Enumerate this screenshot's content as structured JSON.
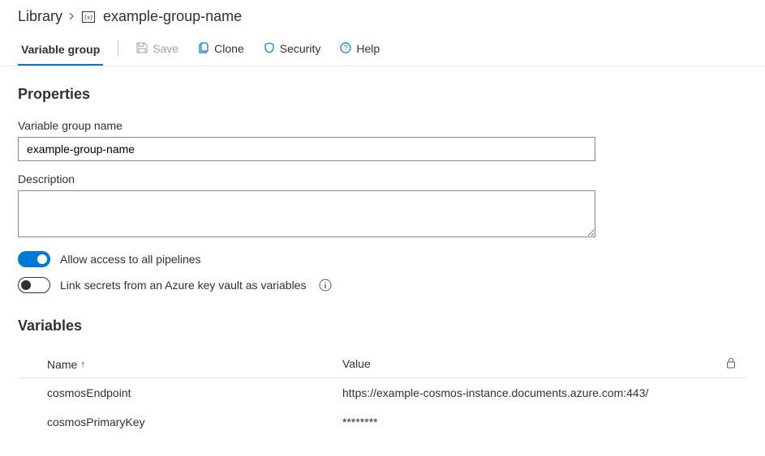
{
  "breadcrumb": {
    "root": "Library",
    "current": "example-group-name"
  },
  "toolbar": {
    "tab": "Variable group",
    "save": "Save",
    "clone": "Clone",
    "security": "Security",
    "help": "Help"
  },
  "properties": {
    "heading": "Properties",
    "name_label": "Variable group name",
    "name_value": "example-group-name",
    "desc_label": "Description",
    "desc_value": "",
    "toggle_access": "Allow access to all pipelines",
    "toggle_vault": "Link secrets from an Azure key vault as variables"
  },
  "variables": {
    "heading": "Variables",
    "col_name": "Name",
    "col_value": "Value",
    "rows": [
      {
        "name": "cosmosEndpoint",
        "value": "https://example-cosmos-instance.documents.azure.com:443/"
      },
      {
        "name": "cosmosPrimaryKey",
        "value": "********"
      }
    ]
  }
}
